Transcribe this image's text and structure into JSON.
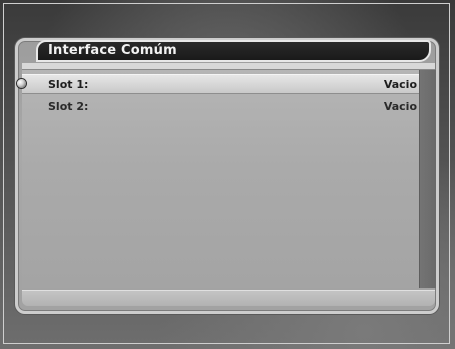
{
  "menu": {
    "title": "Interface Comúm",
    "slots": [
      {
        "label": "Slot 1:",
        "value": "Vacio",
        "selected": true
      },
      {
        "label": "Slot 2:",
        "value": "Vacio",
        "selected": false
      }
    ]
  },
  "icons": {
    "selection": "bullet-icon"
  }
}
